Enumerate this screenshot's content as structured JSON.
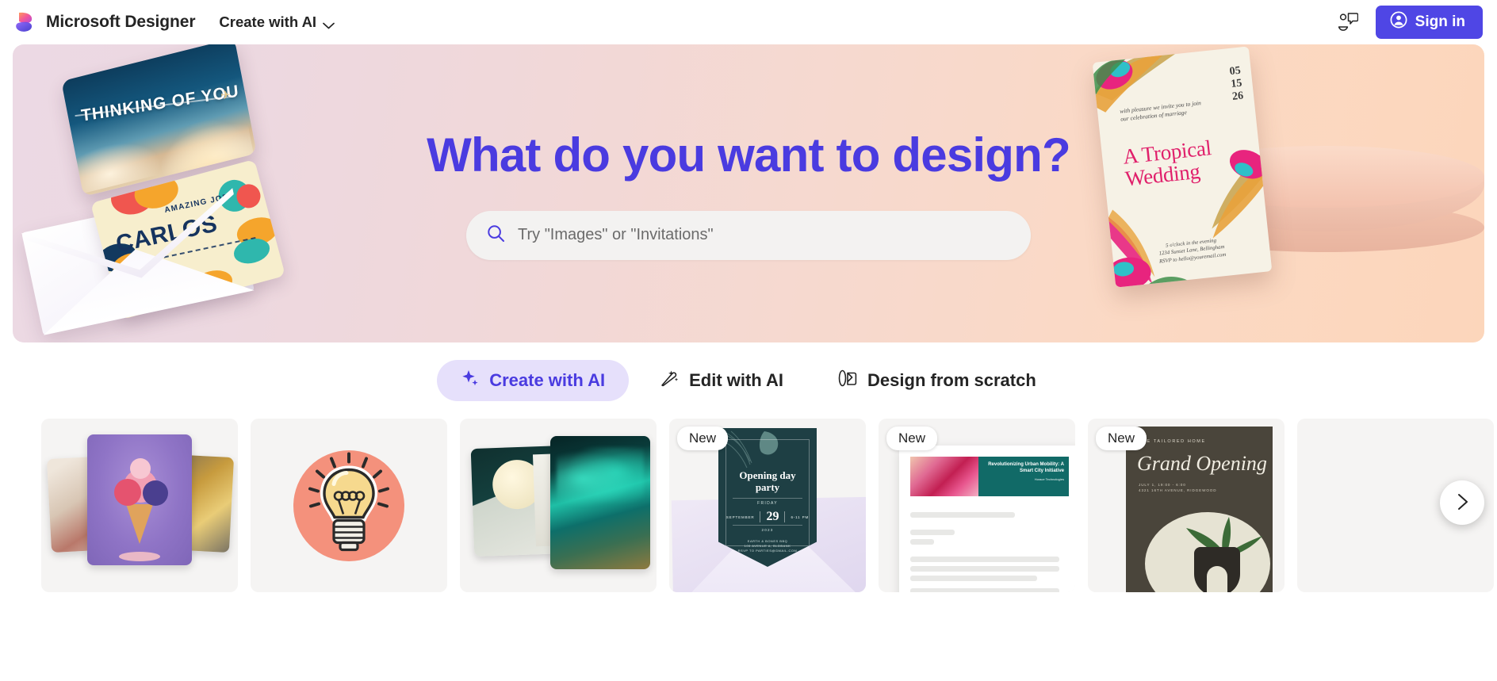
{
  "header": {
    "brand_name": "Microsoft Designer",
    "create_menu_label": "Create with AI",
    "feedback_icon": "feedback-chat-icon",
    "signin_label": "Sign in"
  },
  "hero": {
    "title": "What do you want to design?",
    "search_placeholder": "Try \"Images\" or \"Invitations\"",
    "search_value": "",
    "search_icon": "search-icon",
    "decorations": {
      "thinking_card": {
        "text": "THINKING OF YOU"
      },
      "carlos_card": {
        "subtitle": "AMAZING JOB",
        "name": "CARLOS"
      },
      "wedding_card": {
        "date": "05\n15\n26",
        "intro": "with pleasure we invite you to join our celebration of marriage",
        "title": "A Tropical Wedding",
        "footer": "5 o'clock in the evening\n1234 Sunset Lane, Bellingham\nRSVP to hello@youremail.com"
      }
    }
  },
  "tabs": [
    {
      "label": "Create with AI",
      "icon": "sparkle-icon",
      "active": true
    },
    {
      "label": "Edit with AI",
      "icon": "magic-wand-icon",
      "active": false
    },
    {
      "label": "Design from scratch",
      "icon": "shapes-icon",
      "active": false
    }
  ],
  "cards": [
    {
      "name": "image-collage-card",
      "badge": ""
    },
    {
      "name": "sticker-lightbulb-card",
      "badge": ""
    },
    {
      "name": "wallpaper-aurora-card",
      "badge": ""
    },
    {
      "name": "invitation-card",
      "badge": "New",
      "invite": {
        "title": "Opening day\nparty",
        "weekday": "FRIDAY",
        "month": "SEPTEMBER",
        "day": "29",
        "time": "6-11 PM",
        "year": "2023",
        "address": "EARTH & BONES BBQ\n105 AVENUE A, BLDBANK\nRSVP TO PARTIES@GMAIL.COM"
      }
    },
    {
      "name": "document-card",
      "badge": "New",
      "document": {
        "headline": "Revolutionizing Urban Mobility: A Smart City Initiative",
        "byline": "Horace Technologies"
      }
    },
    {
      "name": "poster-card",
      "badge": "New",
      "poster": {
        "brand": "THE TAILORED HOME",
        "title": "Grand Opening",
        "meta": "JULY 1, 19:00 - 6:00\n4321 16TH AVENUE, RIDGEWOOD"
      }
    }
  ],
  "rail": {
    "next_label": "",
    "next_icon": "chevron-right-icon"
  },
  "colors": {
    "accent": "#4a3be0",
    "signin_bg": "#4f46e5",
    "tab_active_bg": "#e6e0fb",
    "hero_gradient_start": "#ecd9e4",
    "hero_gradient_end": "#fcd6bb"
  }
}
